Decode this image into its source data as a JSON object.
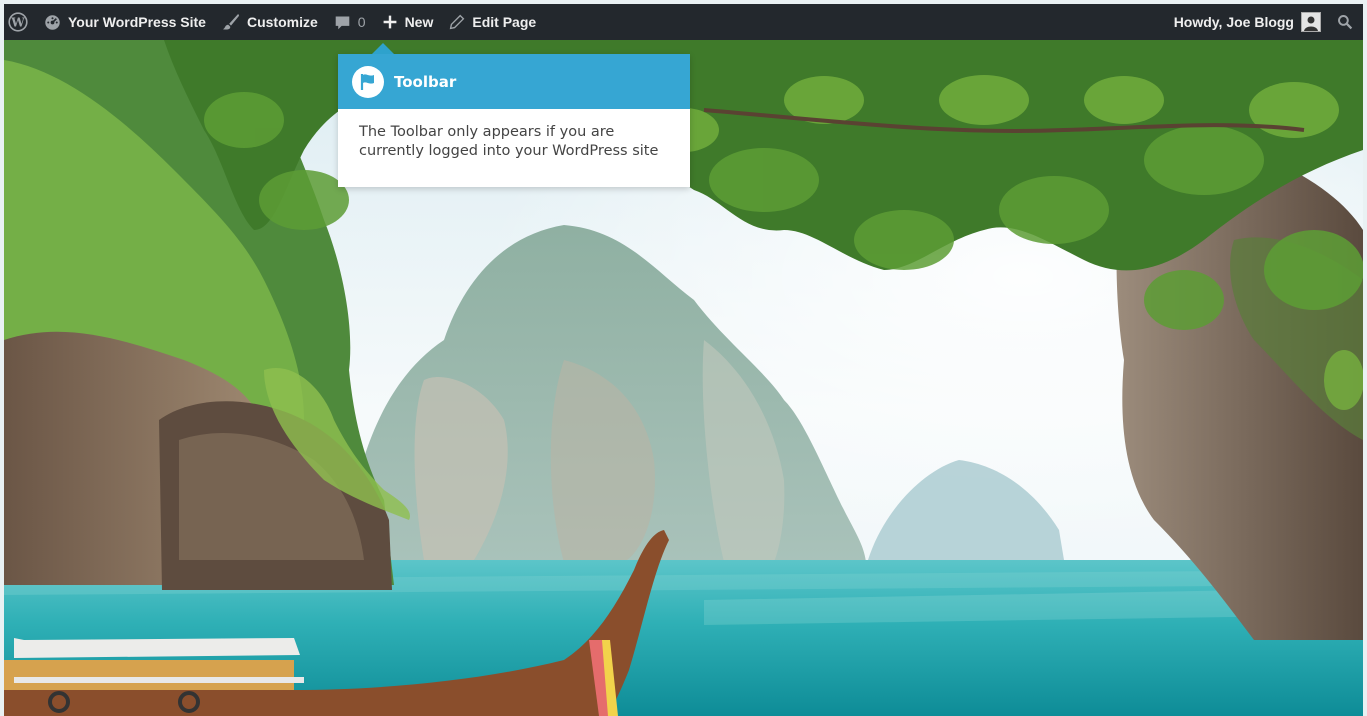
{
  "adminbar": {
    "site_name": "Your WordPress Site",
    "customize": "Customize",
    "comments_count": "0",
    "new": "New",
    "edit_page": "Edit Page",
    "howdy": "Howdy, Joe Blogg"
  },
  "pointer": {
    "title": "Toolbar",
    "body": "The Toolbar only appears if you are currently logged into your WordPress site"
  },
  "colors": {
    "adminbar_bg": "#23282d",
    "pointer_header": "#36a6d3"
  },
  "icons": [
    "wordpress-logo-icon",
    "dashboard-icon",
    "brush-icon",
    "comment-bubble-icon",
    "plus-icon",
    "pencil-icon",
    "search-icon",
    "flag-icon"
  ]
}
